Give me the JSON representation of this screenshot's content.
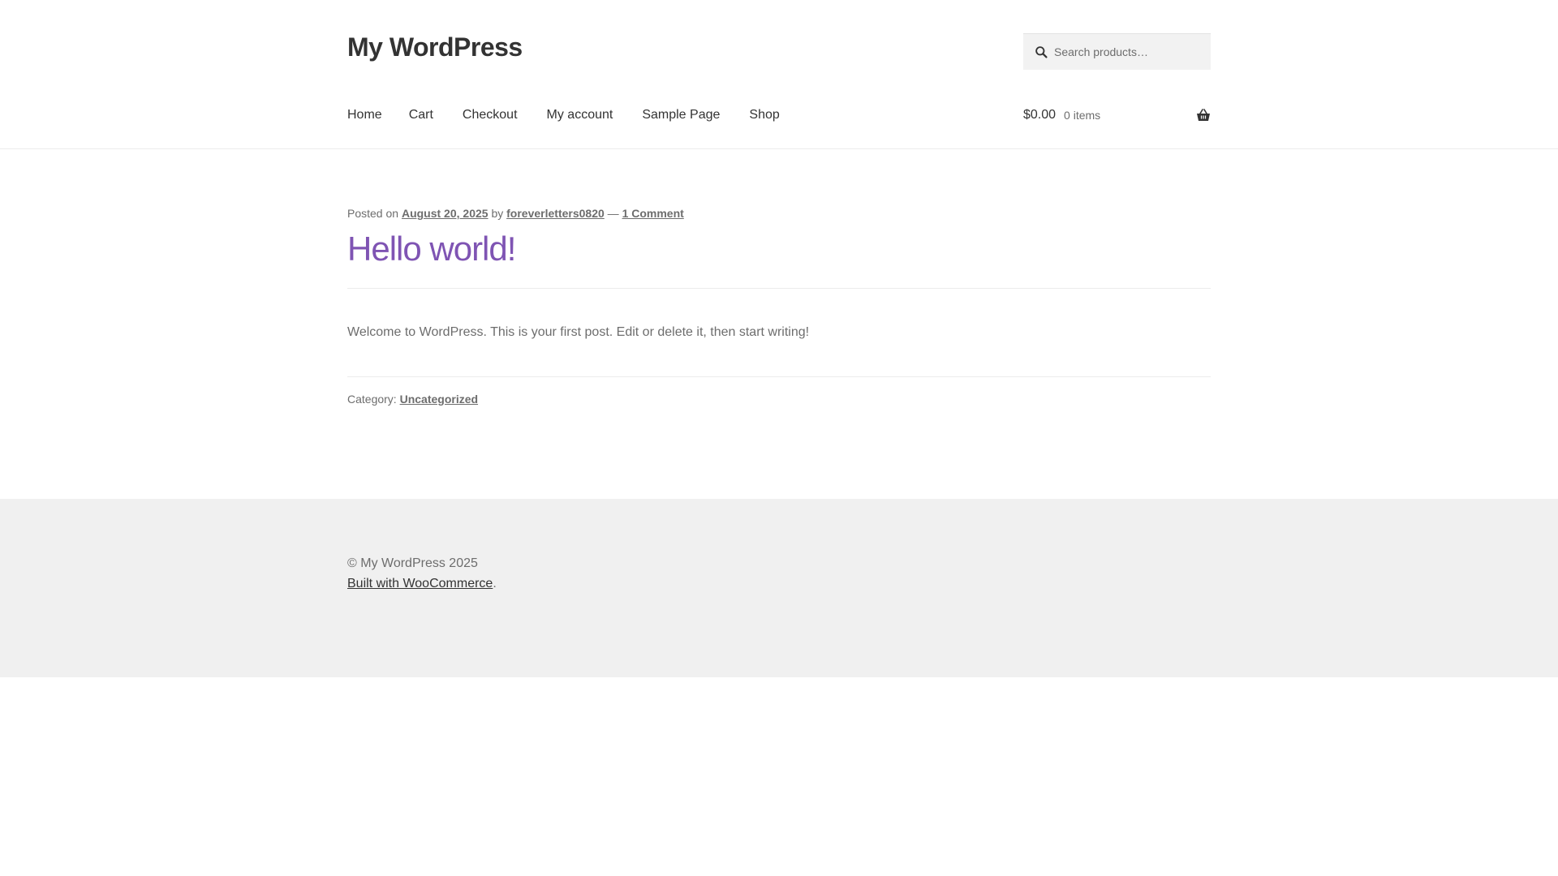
{
  "site": {
    "title": "My WordPress"
  },
  "search": {
    "placeholder": "Search products…"
  },
  "nav": {
    "items": [
      {
        "label": "Home"
      },
      {
        "label": "Cart"
      },
      {
        "label": "Checkout"
      },
      {
        "label": "My account"
      },
      {
        "label": "Sample Page"
      },
      {
        "label": "Shop"
      }
    ]
  },
  "cart": {
    "amount": "$0.00",
    "count": "0 items",
    "icon": "basket-icon"
  },
  "post": {
    "posted_on": "Posted on",
    "date": "August 20, 2025",
    "by": "by",
    "author": "foreverletters0820",
    "dash": "—",
    "comments": "1 Comment",
    "title": "Hello world!",
    "content": "Welcome to WordPress. This is your first post. Edit or delete it, then start writing!",
    "category_label": "Category:",
    "category": "Uncategorized"
  },
  "footer": {
    "copyright": "© My WordPress 2025",
    "built_with": "Built with WooCommerce",
    "period": "."
  },
  "colors": {
    "accent": "#7f54b3",
    "heading": "#333333",
    "text": "#6d6d6d",
    "footer_bg": "#f0f0f0"
  }
}
